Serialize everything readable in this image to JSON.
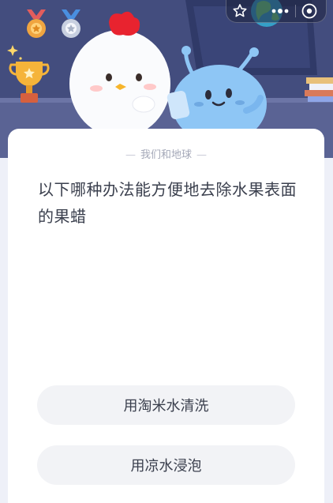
{
  "header": {
    "icons": [
      "bronze-medal-icon",
      "silver-medal-icon",
      "trophy-icon",
      "star-icon",
      "more-dots-icon",
      "close-circle-icon"
    ],
    "mascots": [
      "chick-mascot",
      "blue-alien-mascot"
    ]
  },
  "card": {
    "subtitle": "我们和地球",
    "question": "以下哪种办法能方便地去除水果表面的果蜡",
    "options": [
      {
        "label": "用淘米水清洗"
      },
      {
        "label": "用凉水浸泡"
      }
    ]
  },
  "colors": {
    "banner": "#4b5486",
    "card": "#ffffff",
    "option_bg": "#f2f3f6",
    "text": "#3a3f4d",
    "subtitle": "#a4a8b8"
  }
}
